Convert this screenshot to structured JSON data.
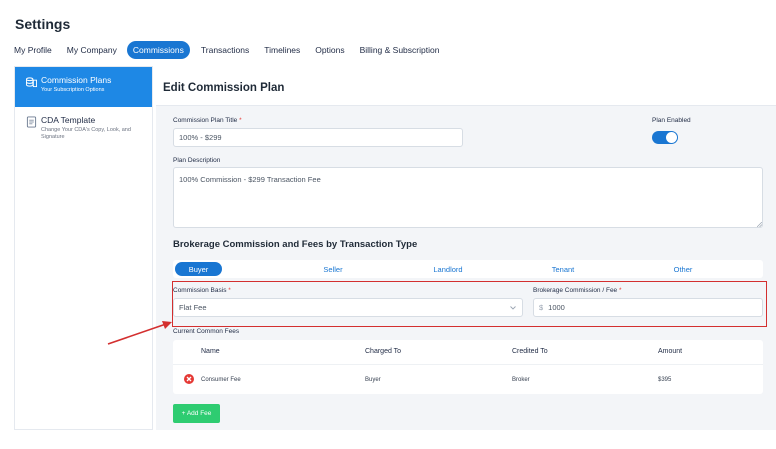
{
  "page": {
    "title": "Settings"
  },
  "tabs": [
    {
      "label": "My Profile",
      "active": false
    },
    {
      "label": "My Company",
      "active": false
    },
    {
      "label": "Commissions",
      "active": true
    },
    {
      "label": "Transactions",
      "active": false
    },
    {
      "label": "Timelines",
      "active": false
    },
    {
      "label": "Options",
      "active": false
    },
    {
      "label": "Billing & Subscription",
      "active": false
    }
  ],
  "left_menu": [
    {
      "title": "Commission Plans",
      "subtitle": "Your Subscription Options",
      "icon": "coins-icon",
      "active": true
    },
    {
      "title": "CDA Template",
      "subtitle": "Change Your CDA's Copy, Look, and Signature",
      "icon": "document-icon",
      "active": false
    }
  ],
  "form": {
    "header": "Edit Commission Plan",
    "plan_title_label": "Commission Plan Title",
    "required_mark": "*",
    "plan_title_value": "100% - $299",
    "plan_enabled_label": "Plan Enabled",
    "plan_enabled": true,
    "description_label": "Plan Description",
    "description_value": "100% Commission - $299 Transaction Fee",
    "section_title": "Brokerage Commission and Fees by Transaction Type",
    "type_tabs": [
      {
        "label": "Buyer",
        "active": true
      },
      {
        "label": "Seller",
        "active": false
      },
      {
        "label": "Landlord",
        "active": false
      },
      {
        "label": "Tenant",
        "active": false
      },
      {
        "label": "Other",
        "active": false
      }
    ],
    "commission_basis_label": "Commission Basis",
    "commission_basis_value": "Flat Fee",
    "brokerage_fee_label": "Brokerage Commission / Fee",
    "currency_symbol": "$",
    "brokerage_fee_value": "1000",
    "common_fees_label": "Current Common Fees",
    "fees_columns": [
      "Name",
      "Charged To",
      "Credited To",
      "Amount"
    ],
    "fees_rows": [
      {
        "name": "Consumer Fee",
        "charged_to": "Buyer",
        "credited_to": "Broker",
        "amount": "$395"
      }
    ],
    "add_fee_label": "+ Add Fee"
  },
  "colors": {
    "accent": "#1976d2",
    "highlight": "#d32f2f",
    "add": "#2ecc71",
    "remove": "#e53935"
  }
}
